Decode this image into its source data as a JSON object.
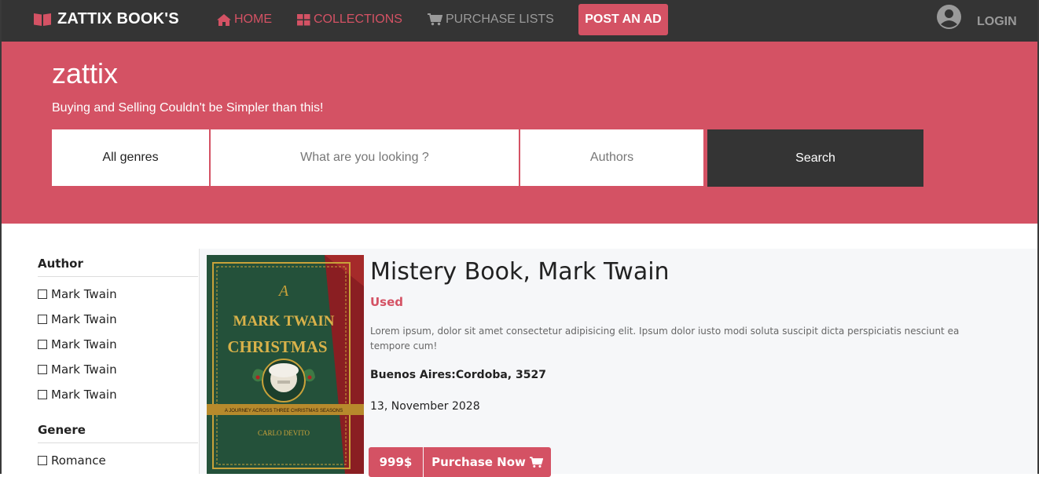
{
  "nav": {
    "brand": "ZATTIX BOOK'S",
    "home": "HOME",
    "collections": "COLLECTIONS",
    "purchase_lists": "PURCHASE LISTS",
    "post_ad": "POST AN AD",
    "login": "LOGIN"
  },
  "hero": {
    "title": "zattix",
    "subtitle": "Buying and Selling Couldn't be Simpler than this!",
    "genre_select": "All genres",
    "query_placeholder": "What are you looking ?",
    "authors_placeholder": "Authors",
    "search_button": "Search"
  },
  "sidebar": {
    "author_heading": "Author",
    "authors": [
      "Mark Twain",
      "Mark Twain",
      "Mark Twain",
      "Mark Twain",
      "Mark Twain"
    ],
    "genre_heading": "Genere",
    "genres": [
      "Romance"
    ]
  },
  "book": {
    "title": "Mistery Book, Mark Twain",
    "condition": "Used",
    "description": "Lorem ipsum, dolor sit amet consectetur adipisicing elit. Ipsum dolor iusto modi soluta suscipit dicta perspiciatis nesciunt ea tempore cum!",
    "location": "Buenos Aires:Cordoba, 3527",
    "date": "13, November 2028",
    "price": "999$",
    "purchase_button": "Purchase Now",
    "cover": {
      "top_text": "A",
      "title_line1": "MARK TWAIN",
      "title_line2": "CHRISTMAS",
      "banner_text": "A JOURNEY ACROSS THREE CHRISTMAS SEASONS",
      "author": "CARLO DEVITO"
    }
  },
  "colors": {
    "accent": "#d45264",
    "nav_bg": "#343434",
    "cover_green": "#24513a",
    "cover_gold": "#c9a23a"
  },
  "icons": [
    "book-icon",
    "home-icon",
    "grid-icon",
    "cart-icon",
    "user-circle-icon",
    "cart-icon"
  ]
}
